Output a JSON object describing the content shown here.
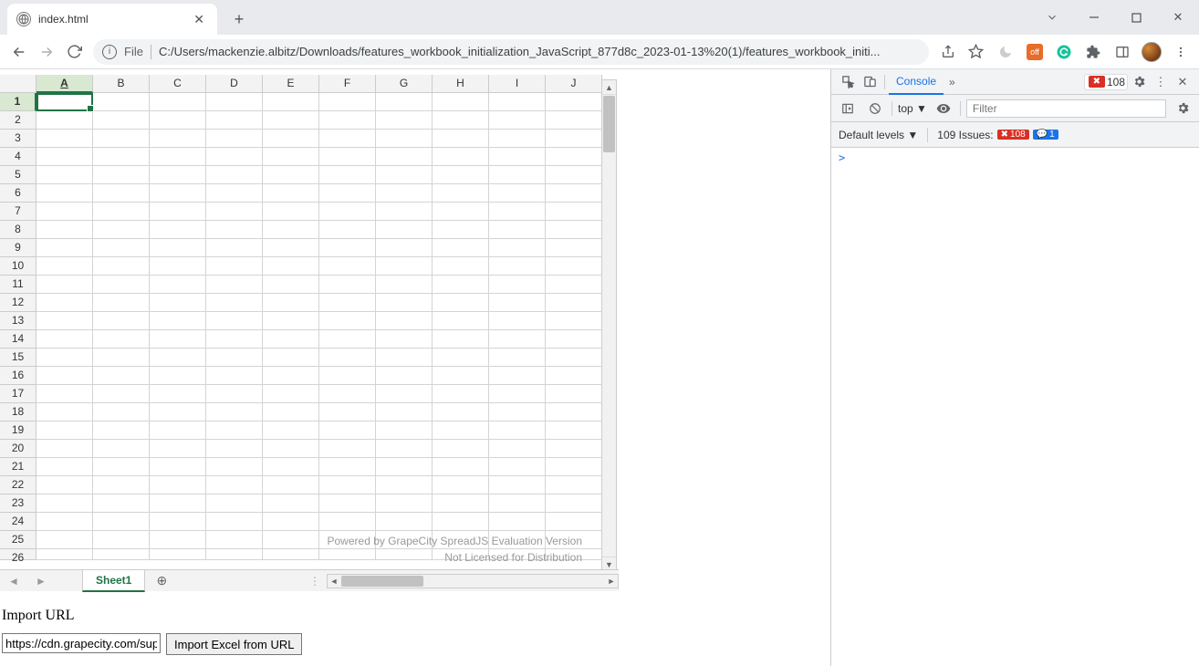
{
  "browser": {
    "tab_title": "index.html",
    "addr_prefix": "File",
    "addr_path": "C:/Users/mackenzie.albitz/Downloads/features_workbook_initialization_JavaScript_877d8c_2023-01-13%20(1)/features_workbook_initi..."
  },
  "spreadsheet": {
    "columns": [
      "A",
      "B",
      "C",
      "D",
      "E",
      "F",
      "G",
      "H",
      "I",
      "J"
    ],
    "rows": [
      "1",
      "2",
      "3",
      "4",
      "5",
      "6",
      "7",
      "8",
      "9",
      "10",
      "11",
      "12",
      "13",
      "14",
      "15",
      "16",
      "17",
      "18",
      "19",
      "20",
      "21",
      "22",
      "23",
      "24",
      "25",
      "26"
    ],
    "active_col": "A",
    "active_row": "1",
    "watermark_line1": "Powered by GrapeCity SpreadJS Evaluation Version",
    "watermark_line2": "Not Licensed for Distribution",
    "sheet_tab": "Sheet1"
  },
  "import": {
    "label": "Import URL",
    "url_value": "https://cdn.grapecity.com/sup",
    "button_label": "Import Excel from URL"
  },
  "devtools": {
    "tab": "Console",
    "error_count": "108",
    "context": "top",
    "filter_placeholder": "Filter",
    "levels": "Default levels",
    "issues_label": "109 Issues:",
    "issues_err": "108",
    "issues_info": "1",
    "prompt": ">"
  }
}
